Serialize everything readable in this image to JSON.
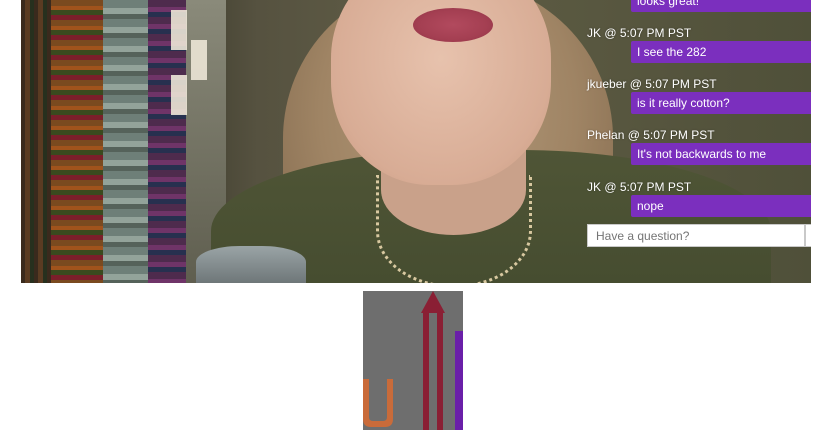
{
  "video": {
    "label": "Live video stream"
  },
  "chat": {
    "messages": [
      {
        "user": "",
        "text": "looks great!"
      },
      {
        "user": "JK @ 5:07 PM PST",
        "text": "I see the 282"
      },
      {
        "user": "jkueber @ 5:07 PM PST",
        "text": "is it really cotton?"
      },
      {
        "user": "Phelan @ 5:07 PM PST",
        "text": "It's not backwards to me"
      },
      {
        "user": "JK @ 5:07 PM PST",
        "text": "nope"
      }
    ],
    "input_placeholder": "Have a question?",
    "send_icon": "send-arrow-icon"
  },
  "colors": {
    "bubble": "#7b2fbe",
    "logo_bg": "#6e6e6e",
    "logo_orange": "#c96b3a",
    "logo_maroon": "#8a1f34",
    "logo_purple": "#6a1fa8"
  }
}
